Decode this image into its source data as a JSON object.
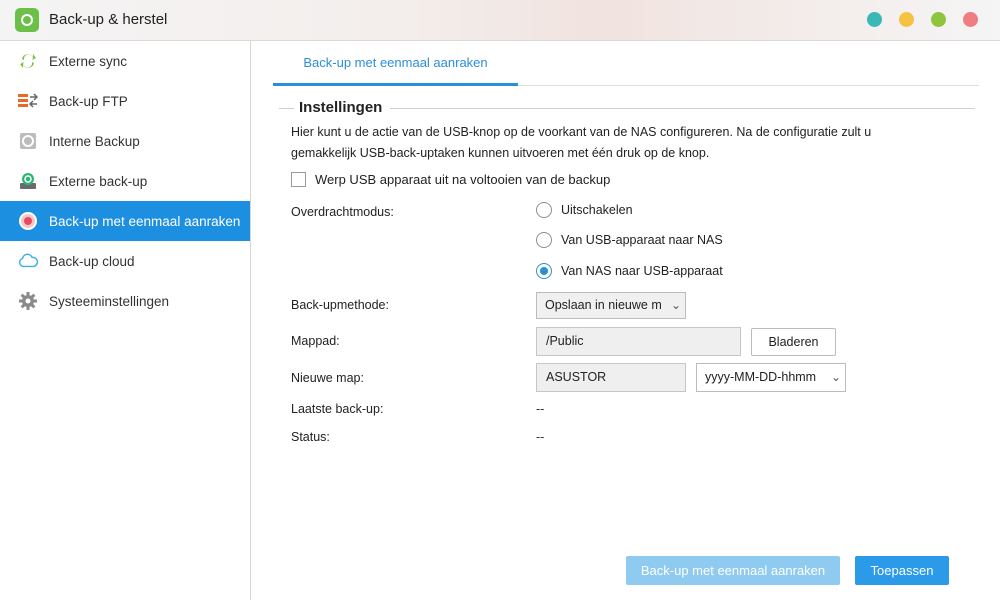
{
  "window": {
    "title": "Back-up & herstel",
    "controls": [
      {
        "name": "help",
        "color": "#3ab7b7"
      },
      {
        "name": "minimize",
        "color": "#f5c342"
      },
      {
        "name": "maximize",
        "color": "#8fc43d"
      },
      {
        "name": "close",
        "color": "#ef7d82"
      }
    ]
  },
  "sidebar": {
    "items": [
      {
        "label": "Externe sync",
        "icon": "sync-icon"
      },
      {
        "label": "Back-up FTP",
        "icon": "ftp-icon"
      },
      {
        "label": "Interne Backup",
        "icon": "internal-backup-icon"
      },
      {
        "label": "Externe back-up",
        "icon": "external-backup-icon"
      },
      {
        "label": "Back-up met eenmaal aanraken",
        "icon": "one-touch-icon",
        "active": true
      },
      {
        "label": "Back-up cloud",
        "icon": "cloud-icon"
      },
      {
        "label": "Systeeminstellingen",
        "icon": "gear-icon"
      }
    ]
  },
  "main": {
    "tab": "Back-up met eenmaal aanraken",
    "section_title": "Instellingen",
    "description": "Hier kunt u de actie van de USB-knop op de voorkant van de NAS configureren. Na de configuratie zult u gemakkelijk USB-back-uptaken kunnen uitvoeren met één druk op de knop.",
    "eject_checkbox": {
      "label": "Werp USB apparaat uit na voltooien van de backup",
      "checked": false
    },
    "transfer_mode": {
      "label": "Overdrachtmodus:",
      "options": [
        {
          "label": "Uitschakelen",
          "checked": false
        },
        {
          "label": "Van USB-apparaat naar NAS",
          "checked": false
        },
        {
          "label": "Van NAS naar USB-apparaat",
          "checked": true
        }
      ]
    },
    "backup_method": {
      "label": "Back-upmethode:",
      "value": "Opslaan in nieuwe m"
    },
    "folder_path": {
      "label": "Mappad:",
      "value": "/Public",
      "browse_label": "Bladeren"
    },
    "new_folder": {
      "label": "Nieuwe map:",
      "value": "ASUSTOR",
      "format_value": "yyyy-MM-DD-hhmm"
    },
    "last_backup": {
      "label": "Laatste back-up:",
      "value": "--"
    },
    "status": {
      "label": "Status:",
      "value": "--"
    },
    "one_touch_button": "Back-up met eenmaal aanraken",
    "apply_button": "Toepassen"
  },
  "colors": {
    "accent": "#1d8fe0",
    "disabled_button": "#8fcbf0",
    "apply_button": "#2b9ae8"
  }
}
